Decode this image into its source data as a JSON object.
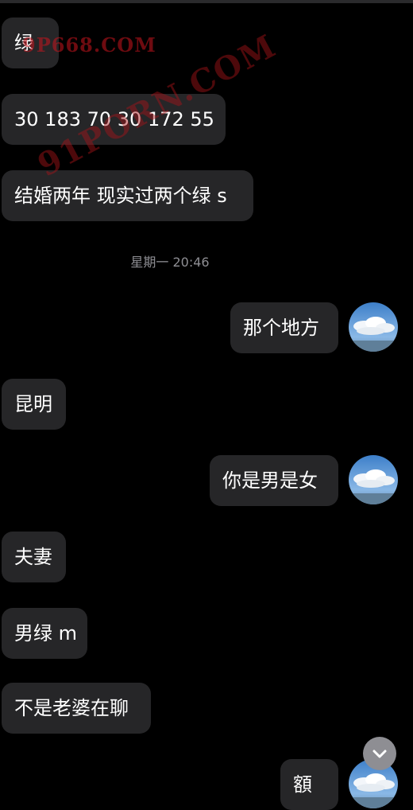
{
  "watermarks": {
    "top": "9P668.COM",
    "diagonal": "91PORN.COM"
  },
  "timestamp": "星期一 20:46",
  "messages": [
    {
      "side": "left",
      "text": "绿"
    },
    {
      "side": "left",
      "text": "30 183 70  30 172 55"
    },
    {
      "side": "left",
      "text": "结婚两年 现实过两个绿 s"
    },
    {
      "side": "right",
      "text": "那个地方"
    },
    {
      "side": "left",
      "text": "昆明"
    },
    {
      "side": "right",
      "text": "你是男是女"
    },
    {
      "side": "left",
      "text": "夫妻"
    },
    {
      "side": "left",
      "text": "男绿 m"
    },
    {
      "side": "left",
      "text": "不是老婆在聊"
    },
    {
      "side": "right",
      "text": "額"
    }
  ],
  "avatar_icon": "sky-cloud-avatar",
  "scroll_button_icon": "chevron-down-icon",
  "colors": {
    "background": "#000000",
    "bubble": "#262628",
    "text": "#ffffff",
    "timestamp": "#8e8e93",
    "watermark": "#c8141e"
  }
}
